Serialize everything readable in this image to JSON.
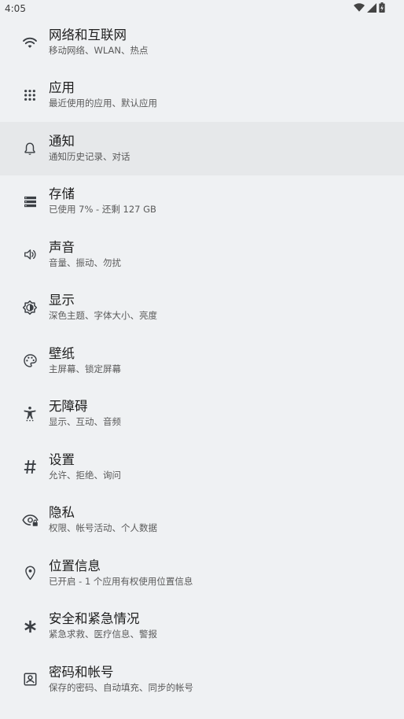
{
  "status_bar": {
    "time": "4:05",
    "icons": [
      "wifi-icon",
      "cellular-signal-icon",
      "battery-charging-icon"
    ]
  },
  "settings": {
    "items": [
      {
        "title": "网络和互联网",
        "subtitle": "移动网络、WLAN、热点",
        "icon": "wifi-icon",
        "highlighted": false
      },
      {
        "title": "应用",
        "subtitle": "最近使用的应用、默认应用",
        "icon": "apps-grid-icon",
        "highlighted": false
      },
      {
        "title": "通知",
        "subtitle": "通知历史记录、对话",
        "icon": "bell-icon",
        "highlighted": true
      },
      {
        "title": "存储",
        "subtitle": "已使用 7% - 还剩 127 GB",
        "icon": "storage-icon",
        "highlighted": false
      },
      {
        "title": "声音",
        "subtitle": "音量、振动、勿扰",
        "icon": "speaker-icon",
        "highlighted": false
      },
      {
        "title": "显示",
        "subtitle": "深色主题、字体大小、亮度",
        "icon": "brightness-icon",
        "highlighted": false
      },
      {
        "title": "壁纸",
        "subtitle": "主屏幕、锁定屏幕",
        "icon": "palette-icon",
        "highlighted": false
      },
      {
        "title": "无障碍",
        "subtitle": "显示、互动、音频",
        "icon": "accessibility-icon",
        "highlighted": false
      },
      {
        "title": "设置",
        "subtitle": "允许、拒绝、询问",
        "icon": "hashtag-icon",
        "highlighted": false
      },
      {
        "title": "隐私",
        "subtitle": "权限、帐号活动、个人数据",
        "icon": "privacy-eye-lock-icon",
        "highlighted": false
      },
      {
        "title": "位置信息",
        "subtitle": "已开启 - 1 个应用有权使用位置信息",
        "icon": "location-pin-icon",
        "highlighted": false
      },
      {
        "title": "安全和紧急情况",
        "subtitle": "紧急求救、医疗信息、警报",
        "icon": "asterisk-icon",
        "highlighted": false
      },
      {
        "title": "密码和帐号",
        "subtitle": "保存的密码、自动填充、同步的帐号",
        "icon": "account-box-icon",
        "highlighted": false
      }
    ]
  },
  "colors": {
    "background": "#eff1f3",
    "highlight": "#e6e8ea",
    "title": "#1e1e1e",
    "subtitle": "#5a5a5a",
    "icon": "#3b3f44"
  }
}
